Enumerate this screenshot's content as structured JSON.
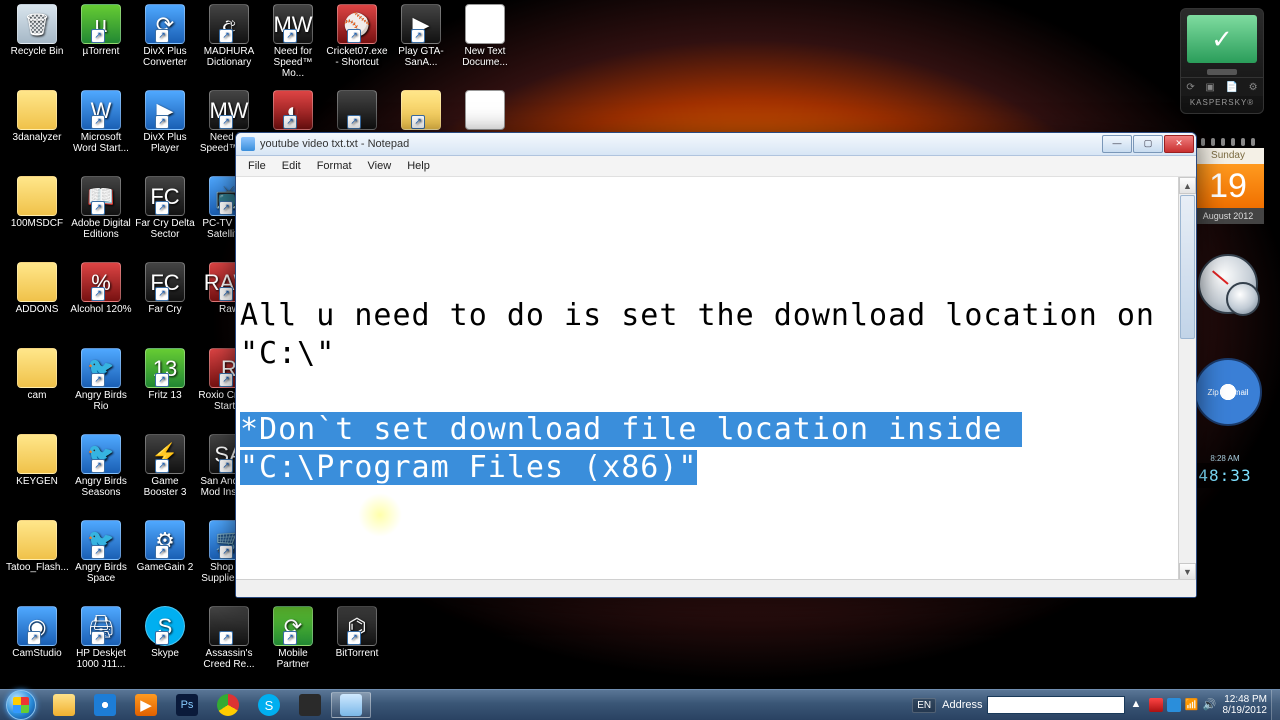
{
  "desktop_icons": [
    {
      "row": 0,
      "col": 0,
      "label": "Recycle Bin",
      "cls": "bin",
      "sc": false,
      "glyph": "🗑"
    },
    {
      "row": 0,
      "col": 1,
      "label": "µTorrent",
      "cls": "green",
      "sc": true,
      "glyph": "µ"
    },
    {
      "row": 0,
      "col": 2,
      "label": "DivX Plus Converter",
      "cls": "blue",
      "sc": true,
      "glyph": "⟳"
    },
    {
      "row": 0,
      "col": 3,
      "label": "MADHURA Dictionary",
      "cls": "dark",
      "sc": true,
      "glyph": "අ"
    },
    {
      "row": 0,
      "col": 4,
      "label": "Need for Speed™ Mo...",
      "cls": "dark",
      "sc": true,
      "glyph": "MW"
    },
    {
      "row": 0,
      "col": 5,
      "label": "Cricket07.exe - Shortcut",
      "cls": "red",
      "sc": true,
      "glyph": "⚾"
    },
    {
      "row": 0,
      "col": 6,
      "label": "Play GTA-SanA...",
      "cls": "dark",
      "sc": true,
      "glyph": "▶"
    },
    {
      "row": 0,
      "col": 7,
      "label": "New Text Docume...",
      "cls": "txt",
      "sc": false,
      "glyph": ""
    },
    {
      "row": 1,
      "col": 0,
      "label": "3danalyzer",
      "cls": "folder",
      "sc": false,
      "glyph": ""
    },
    {
      "row": 1,
      "col": 1,
      "label": "Microsoft Word Start...",
      "cls": "blue",
      "sc": true,
      "glyph": "W"
    },
    {
      "row": 1,
      "col": 2,
      "label": "DivX Plus Player",
      "cls": "blue",
      "sc": true,
      "glyph": "▶"
    },
    {
      "row": 1,
      "col": 3,
      "label": "Need for Speed™ M...",
      "cls": "dark",
      "sc": true,
      "glyph": "MW"
    },
    {
      "row": 1,
      "col": 4,
      "label": "",
      "cls": "red",
      "sc": true,
      "glyph": "◐"
    },
    {
      "row": 1,
      "col": 5,
      "label": "",
      "cls": "dark",
      "sc": true,
      "glyph": ""
    },
    {
      "row": 1,
      "col": 6,
      "label": "",
      "cls": "folder",
      "sc": true,
      "glyph": ""
    },
    {
      "row": 1,
      "col": 7,
      "label": "",
      "cls": "txt",
      "sc": false,
      "glyph": ""
    },
    {
      "row": 2,
      "col": 0,
      "label": "100MSDCF",
      "cls": "folder",
      "sc": false,
      "glyph": ""
    },
    {
      "row": 2,
      "col": 1,
      "label": "Adobe Digital Editions",
      "cls": "dark",
      "sc": true,
      "glyph": "📖"
    },
    {
      "row": 2,
      "col": 2,
      "label": "Far Cry Delta Sector",
      "cls": "dark",
      "sc": true,
      "glyph": "FC"
    },
    {
      "row": 2,
      "col": 3,
      "label": "PC-TV Free Satellite...",
      "cls": "blue",
      "sc": true,
      "glyph": "📺"
    },
    {
      "row": 3,
      "col": 0,
      "label": "ADDONS",
      "cls": "folder",
      "sc": false,
      "glyph": ""
    },
    {
      "row": 3,
      "col": 1,
      "label": "Alcohol 120%",
      "cls": "red",
      "sc": true,
      "glyph": "%"
    },
    {
      "row": 3,
      "col": 2,
      "label": "Far Cry",
      "cls": "dark",
      "sc": true,
      "glyph": "FC"
    },
    {
      "row": 3,
      "col": 3,
      "label": "Raw",
      "cls": "red",
      "sc": true,
      "glyph": "RAW"
    },
    {
      "row": 4,
      "col": 0,
      "label": "cam",
      "cls": "folder",
      "sc": false,
      "glyph": ""
    },
    {
      "row": 4,
      "col": 1,
      "label": "Angry Birds Rio",
      "cls": "blue",
      "sc": true,
      "glyph": "🐦"
    },
    {
      "row": 4,
      "col": 2,
      "label": "Fritz 13",
      "cls": "green",
      "sc": true,
      "glyph": "13"
    },
    {
      "row": 4,
      "col": 3,
      "label": "Roxio Creat... Starter",
      "cls": "red",
      "sc": true,
      "glyph": "R"
    },
    {
      "row": 5,
      "col": 0,
      "label": "KEYGEN",
      "cls": "folder",
      "sc": false,
      "glyph": ""
    },
    {
      "row": 5,
      "col": 1,
      "label": "Angry Birds Seasons",
      "cls": "blue",
      "sc": true,
      "glyph": "🐦"
    },
    {
      "row": 5,
      "col": 2,
      "label": "Game Booster 3",
      "cls": "dark",
      "sc": true,
      "glyph": "⚡"
    },
    {
      "row": 5,
      "col": 3,
      "label": "San Andreas Mod Install...",
      "cls": "dark",
      "sc": true,
      "glyph": "SA"
    },
    {
      "row": 6,
      "col": 0,
      "label": "Tatoo_Flash...",
      "cls": "folder",
      "sc": false,
      "glyph": ""
    },
    {
      "row": 6,
      "col": 1,
      "label": "Angry Birds Space",
      "cls": "blue",
      "sc": true,
      "glyph": "🐦"
    },
    {
      "row": 6,
      "col": 2,
      "label": "GameGain 2",
      "cls": "blue",
      "sc": true,
      "glyph": "⚙"
    },
    {
      "row": 6,
      "col": 3,
      "label": "Shop for Supplies - ...",
      "cls": "blue",
      "sc": true,
      "glyph": "🛒"
    },
    {
      "row": 7,
      "col": 0,
      "label": "CamStudio",
      "cls": "blue",
      "sc": true,
      "glyph": "◉"
    },
    {
      "row": 7,
      "col": 1,
      "label": "HP Deskjet 1000 J11...",
      "cls": "blue",
      "sc": true,
      "glyph": "🖨"
    },
    {
      "row": 7,
      "col": 2,
      "label": "Skype",
      "cls": "skype",
      "sc": true,
      "glyph": "S"
    },
    {
      "row": 7,
      "col": 3,
      "label": "Assassin's Creed Re...",
      "cls": "dark",
      "sc": true,
      "glyph": ""
    },
    {
      "row": 7,
      "col": 4,
      "label": "Mobile Partner",
      "cls": "green",
      "sc": true,
      "glyph": "⟳"
    },
    {
      "row": 7,
      "col": 5,
      "label": "BitTorrent",
      "cls": "dark",
      "sc": true,
      "glyph": "⌬"
    }
  ],
  "kaspersky_label": "KASPERSKY®",
  "calendar": {
    "day": "Sunday",
    "num": "19",
    "month": "August 2012"
  },
  "winzip_text": "Zip & Email",
  "gadget_clock": {
    "time": "48:33",
    "ampm": "8:28 AM"
  },
  "notepad": {
    "title": "youtube video txt.txt - Notepad",
    "menus": [
      "File",
      "Edit",
      "Format",
      "View",
      "Help"
    ],
    "line1": "All u need to do is set the download location on \"C:\\\"",
    "sel1": "*Don`t set download file location inside ",
    "sel2": "\"C:\\Program Files (x86)\""
  },
  "taskbar": {
    "lang": "EN",
    "address_label": "Address",
    "address_value": "",
    "clock_time": "12:48 PM",
    "clock_date": "8/19/2012"
  }
}
